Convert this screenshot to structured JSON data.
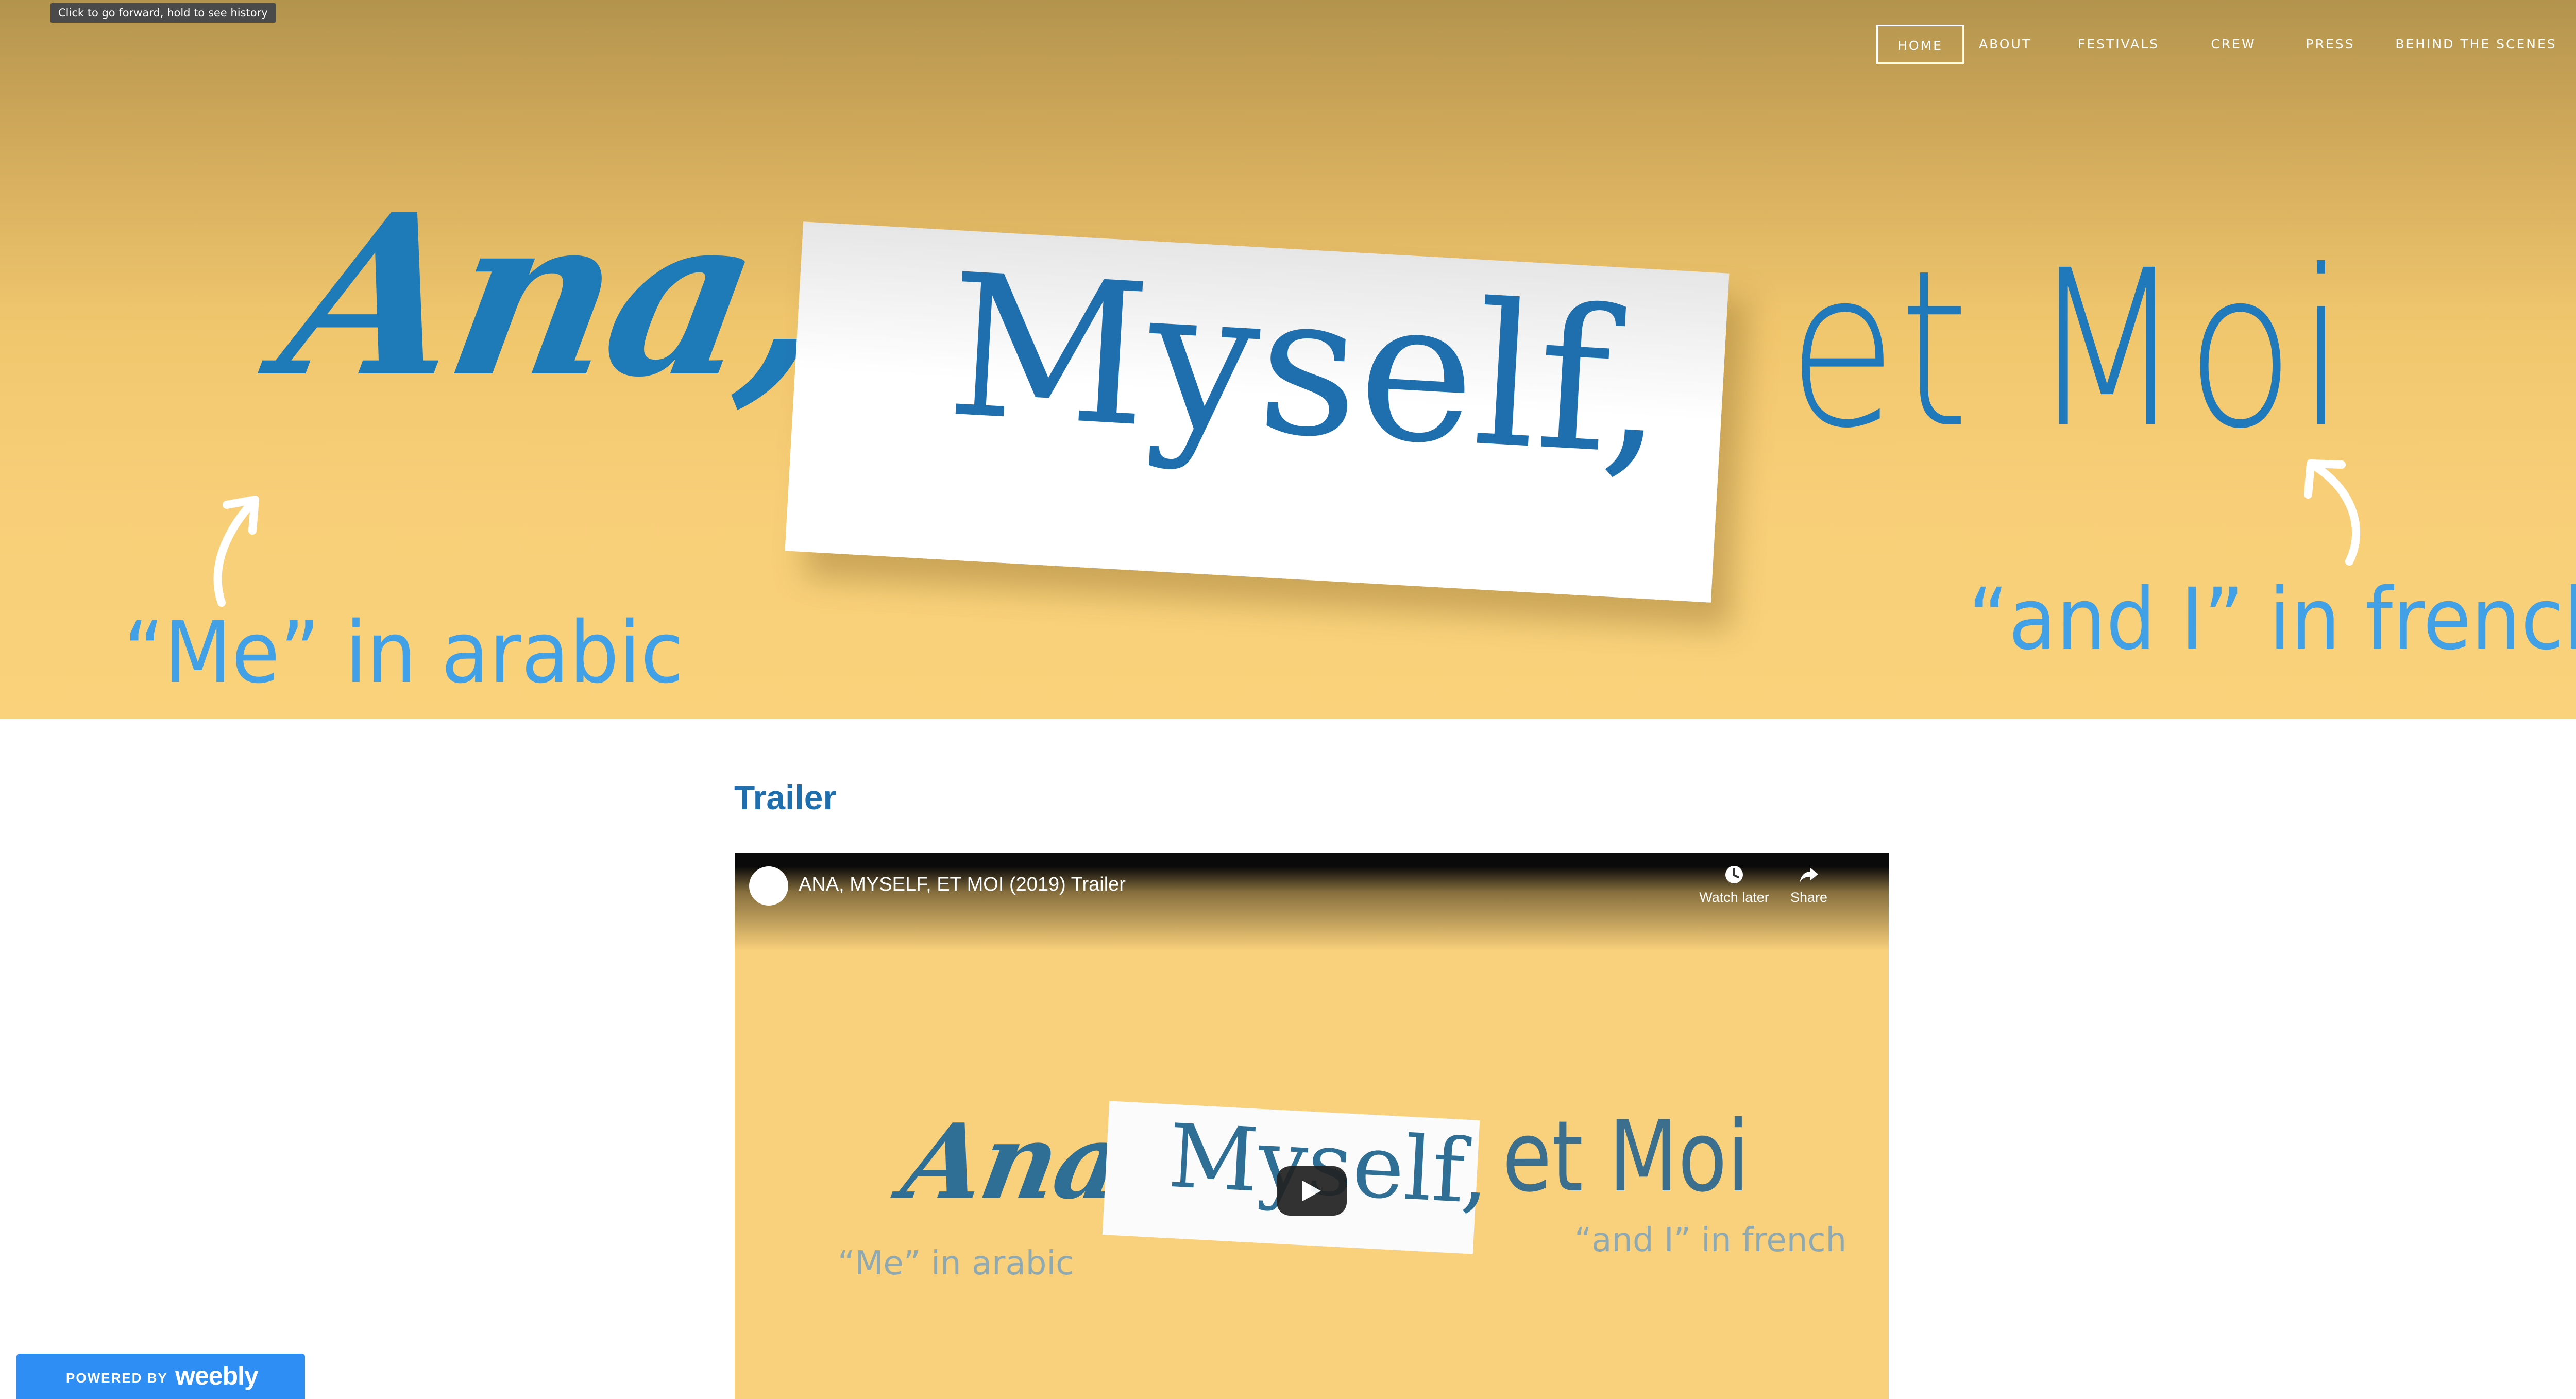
{
  "tooltip": "Click to go forward, hold to see history",
  "nav": {
    "items": [
      {
        "label": "HOME",
        "active": true
      },
      {
        "label": "ABOUT",
        "active": false
      },
      {
        "label": "FESTIVALS",
        "active": false
      },
      {
        "label": "CREW",
        "active": false
      },
      {
        "label": "PRESS",
        "active": false
      },
      {
        "label": "BEHIND THE SCENES",
        "active": false
      }
    ]
  },
  "hero": {
    "word1": "Ana,",
    "word2": "Myself,",
    "word3": "et Moi",
    "note_left": "“Me” in arabic",
    "note_right": "“and I” in french"
  },
  "main": {
    "section_title": "Trailer"
  },
  "video": {
    "title": "ANA, MYSELF, ET MOI (2019) Trailer",
    "watch_later": "Watch later",
    "share": "Share",
    "thumb_word1": "Ana,",
    "thumb_word2": "Myself,",
    "thumb_word3": "et Moi",
    "thumb_note_left": "“Me” in arabic",
    "thumb_note_right": "“and I” in french"
  },
  "badge": {
    "prefix": "POWERED BY",
    "brand": "weebly"
  },
  "colors": {
    "accent": "#1f6fae",
    "hero_gold": "#f9d27b",
    "badge_blue": "#2f8ef3"
  }
}
